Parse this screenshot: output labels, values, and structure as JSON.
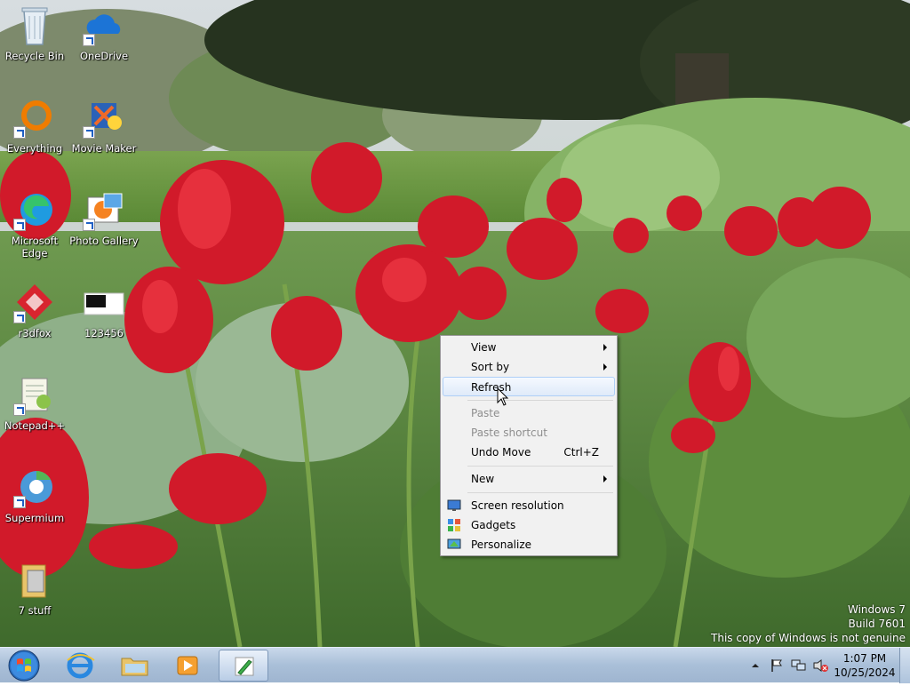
{
  "desktop_icons": [
    {
      "label": "Recycle Bin",
      "icon": "recycle-bin-icon"
    },
    {
      "label": "OneDrive",
      "icon": "onedrive-icon"
    },
    {
      "label": "Everything",
      "icon": "everything-icon"
    },
    {
      "label": "Movie Maker",
      "icon": "movie-maker-icon"
    },
    {
      "label": "Microsoft Edge",
      "icon": "edge-icon"
    },
    {
      "label": "Photo Gallery",
      "icon": "photo-gallery-icon"
    },
    {
      "label": "r3dfox",
      "icon": "r3dfox-icon"
    },
    {
      "label": "123456",
      "icon": "image-file-icon"
    },
    {
      "label": "Notepad++",
      "icon": "notepadpp-icon"
    },
    {
      "label": "Supermium",
      "icon": "supermium-icon"
    },
    {
      "label": "7 stuff",
      "icon": "folder-icon"
    }
  ],
  "context_menu": {
    "items": [
      {
        "label": "View",
        "submenu": true
      },
      {
        "label": "Sort by",
        "submenu": true
      },
      {
        "label": "Refresh",
        "highlighted": true
      },
      {
        "label": "Paste",
        "disabled": true
      },
      {
        "label": "Paste shortcut",
        "disabled": true
      },
      {
        "label": "Undo Move",
        "shortcut": "Ctrl+Z"
      },
      {
        "label": "New",
        "submenu": true
      },
      {
        "label": "Screen resolution",
        "icon": "screen-resolution-icon"
      },
      {
        "label": "Gadgets",
        "icon": "gadgets-icon"
      },
      {
        "label": "Personalize",
        "icon": "personalize-icon"
      }
    ]
  },
  "watermark": {
    "line1": "Windows 7",
    "line2": "Build 7601",
    "line3": "This copy of Windows is not genuine"
  },
  "taskbar": {
    "pinned": [
      "Internet Explorer",
      "Windows Explorer",
      "Windows Media Player",
      "Active window"
    ],
    "clock": {
      "time": "1:07 PM",
      "date": "10/25/2024"
    }
  },
  "colors": {
    "taskbar": "#a9bfd8",
    "menu_bg": "#f1f1f1",
    "menu_highlight": "#dfeaf9"
  }
}
